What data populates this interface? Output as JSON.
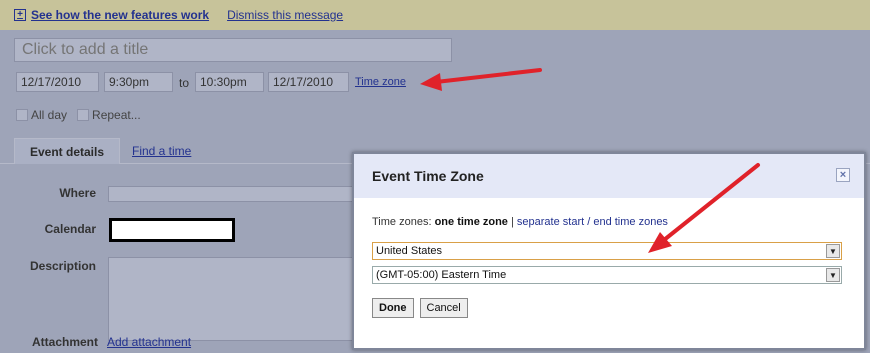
{
  "banner": {
    "features_link": "See how the new features work",
    "dismiss_link": "Dismiss this message"
  },
  "event": {
    "title_placeholder": "Click to add a title",
    "start_date": "12/17/2010",
    "start_time": "9:30pm",
    "to_label": "to",
    "end_time": "10:30pm",
    "end_date": "12/17/2010",
    "timezone_link": "Time zone",
    "all_day_label": "All day",
    "repeat_label": "Repeat..."
  },
  "tabs": {
    "event_details": "Event details",
    "find_a_time": "Find a time"
  },
  "form": {
    "where_label": "Where",
    "calendar_label": "Calendar",
    "description_label": "Description",
    "attachment_label": "Attachment",
    "add_attachment_link": "Add attachment"
  },
  "dialog": {
    "title": "Event Time Zone",
    "close_symbol": "×",
    "timezones_prefix": "Time zones:",
    "one_time_zone": "one time zone",
    "separator": "|",
    "separate_link": "separate start / end time zones",
    "country_select": "United States",
    "zone_select": "(GMT-05:00) Eastern Time",
    "done_button": "Done",
    "cancel_button": "Cancel"
  },
  "colors": {
    "annotation_arrow": "#e0222a",
    "link": "#23328f"
  }
}
